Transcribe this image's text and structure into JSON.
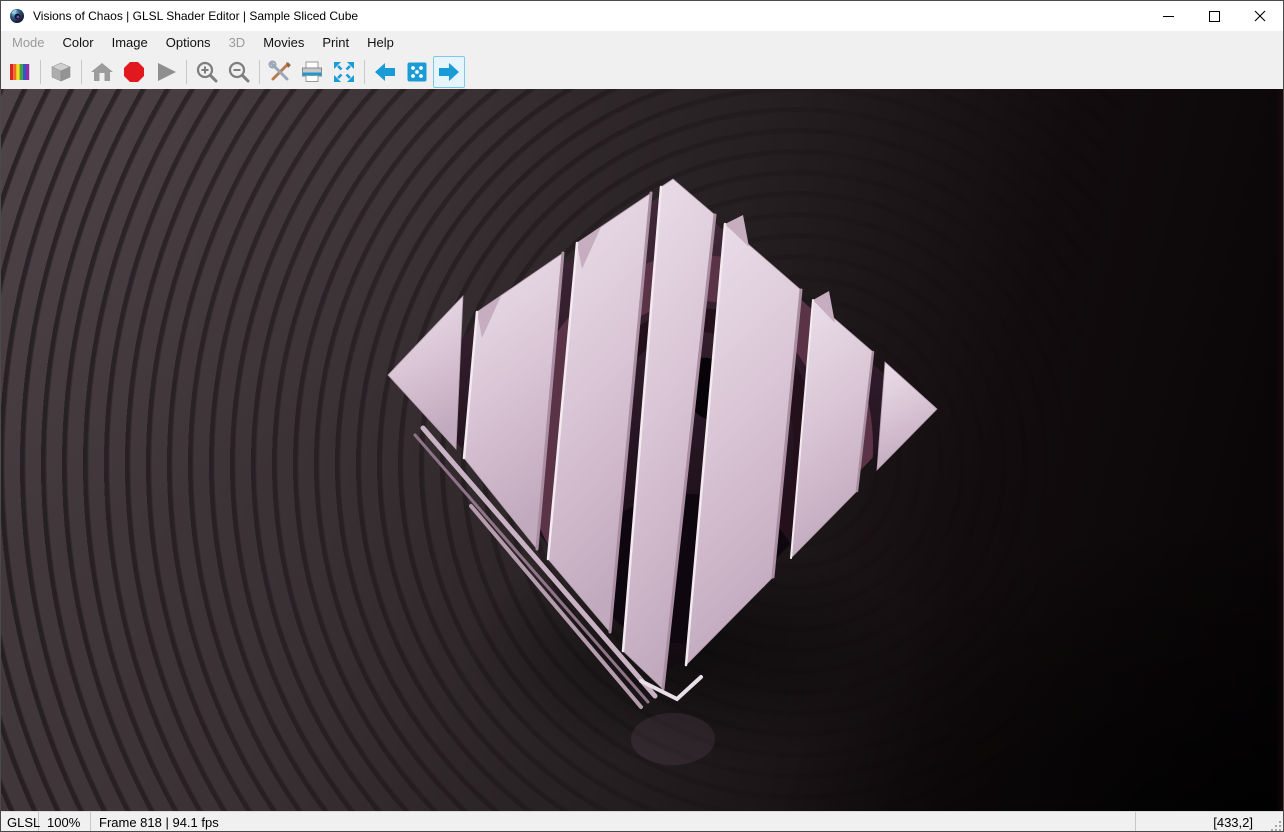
{
  "window": {
    "title": "Visions of Chaos | GLSL Shader Editor | Sample Sliced Cube"
  },
  "menubar": {
    "items": [
      {
        "label": "Mode",
        "enabled": false
      },
      {
        "label": "Color",
        "enabled": true
      },
      {
        "label": "Image",
        "enabled": true
      },
      {
        "label": "Options",
        "enabled": true
      },
      {
        "label": "3D",
        "enabled": false
      },
      {
        "label": "Movies",
        "enabled": true
      },
      {
        "label": "Print",
        "enabled": true
      },
      {
        "label": "Help",
        "enabled": true
      }
    ]
  },
  "toolbar": {
    "icons": [
      "color-palette",
      "cube",
      "home",
      "stop",
      "play",
      "zoom-in",
      "zoom-out",
      "tools",
      "print",
      "fit-to-window",
      "previous-shader",
      "random-shader",
      "next-shader"
    ],
    "accent_blue": "#189bd7",
    "stop_red": "#e2181f"
  },
  "canvas": {
    "colors": {
      "object_pink": "#dcc8d7",
      "interior_maroon": "#3f2734",
      "background_brown": "#3a3134"
    }
  },
  "statusbar": {
    "mode": "GLSL",
    "zoom": "100%",
    "frame_info": "Frame 818 | 94.1 fps",
    "coordinates": "[433,2]"
  }
}
